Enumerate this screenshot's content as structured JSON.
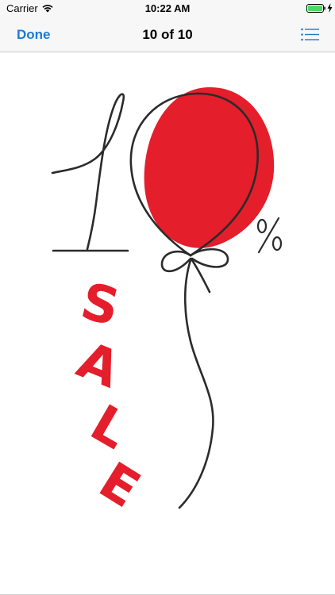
{
  "status_bar": {
    "carrier": "Carrier",
    "time": "10:22 AM",
    "wifi_icon": "wifi-icon",
    "battery_icon": "battery-full-icon",
    "charging_icon": "charging-bolt-icon",
    "battery_color": "#4cd964"
  },
  "nav": {
    "done_label": "Done",
    "title": "10 of 10",
    "list_icon": "list-icon",
    "accent_color": "#1a7bd6"
  },
  "artwork": {
    "number": "10",
    "percent": "%",
    "word_letters": [
      "S",
      "A",
      "L",
      "E"
    ],
    "balloon_color": "#e41e2b",
    "line_color": "#2b2b2b"
  }
}
